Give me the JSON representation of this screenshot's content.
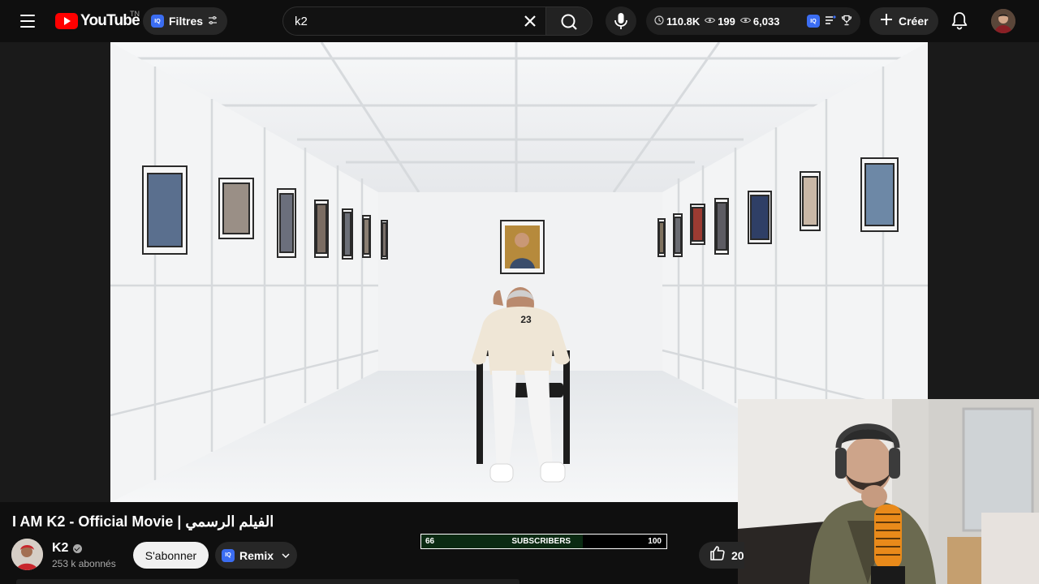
{
  "header": {
    "logo_text": "YouTube",
    "country_code": "TN",
    "filter_label": "Filtres",
    "iq_badge": "IQ",
    "search_query": "k2",
    "stats": {
      "views": "110.8K",
      "watching": "199",
      "count": "6,033"
    },
    "create_label": "Créer"
  },
  "video": {
    "title": "I AM K2 - Official Movie | الفيلم الرسمي",
    "jersey_number": "23"
  },
  "channel": {
    "name": "K2",
    "subscribers": "253 k abonnés",
    "subscribe_label": "S'abonner",
    "remix_label": "Remix"
  },
  "subscriber_bar": {
    "current": "66",
    "label": "SUBSCRIBERS",
    "goal": "100",
    "progress": 0.66
  },
  "actions": {
    "like_count": "20"
  },
  "colors": {
    "background": "#0f0f0f",
    "brand_red": "#ff0000",
    "iq_blue": "#3b6df2",
    "pill_gray": "#272727"
  }
}
